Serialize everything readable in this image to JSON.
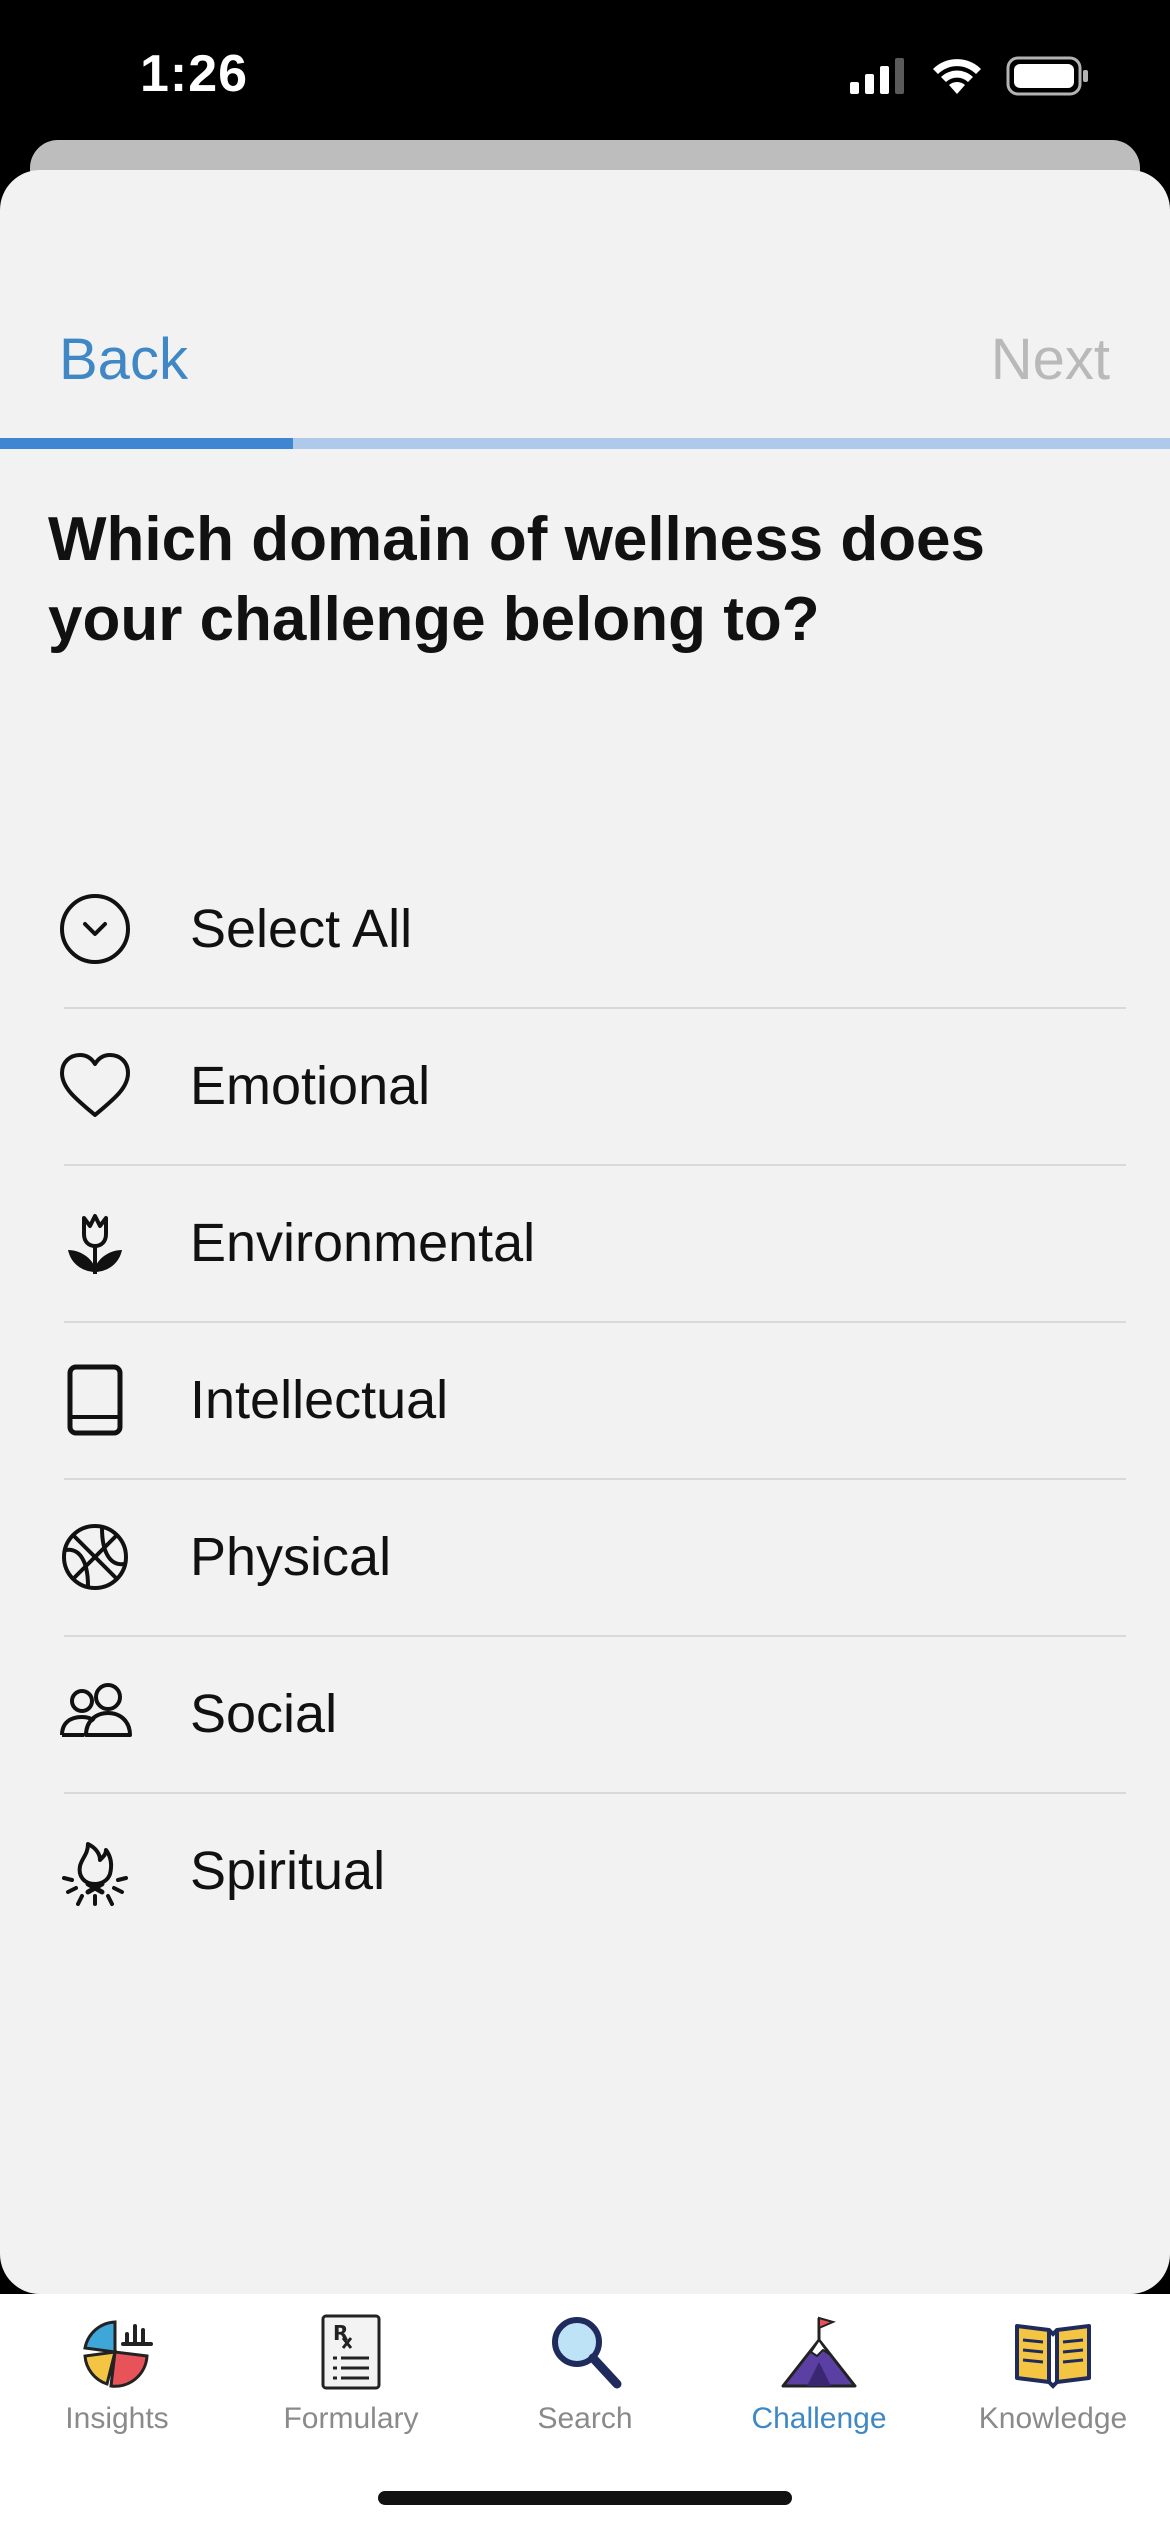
{
  "status_bar": {
    "time": "1:26",
    "signal_icon": "cellular-signal-icon",
    "wifi_icon": "wifi-icon",
    "battery_icon": "battery-icon"
  },
  "nav": {
    "back_label": "Back",
    "next_label": "Next"
  },
  "progress": {
    "fraction": 0.25
  },
  "question": "Which domain of wellness does your challenge belong to?",
  "options": [
    {
      "label": "Select All",
      "icon": "chevron-down-circle-icon"
    },
    {
      "label": "Emotional",
      "icon": "heart-icon"
    },
    {
      "label": "Environmental",
      "icon": "flower-icon"
    },
    {
      "label": "Intellectual",
      "icon": "book-icon"
    },
    {
      "label": "Physical",
      "icon": "basketball-icon"
    },
    {
      "label": "Social",
      "icon": "people-icon"
    },
    {
      "label": "Spiritual",
      "icon": "campfire-icon"
    }
  ],
  "tabs": [
    {
      "label": "Insights",
      "icon": "insights-chart-icon",
      "active": false
    },
    {
      "label": "Formulary",
      "icon": "prescription-icon",
      "active": false
    },
    {
      "label": "Search",
      "icon": "magnifier-icon",
      "active": false
    },
    {
      "label": "Challenge",
      "icon": "mountain-flag-icon",
      "active": true
    },
    {
      "label": "Knowledge",
      "icon": "open-book-icon",
      "active": false
    }
  ],
  "colors": {
    "accent": "#3f88c5",
    "disabled": "#b9b9b9",
    "progress_fill": "#3f86d2",
    "progress_track": "#aec9ea",
    "sheet": "#f2f2f2"
  }
}
